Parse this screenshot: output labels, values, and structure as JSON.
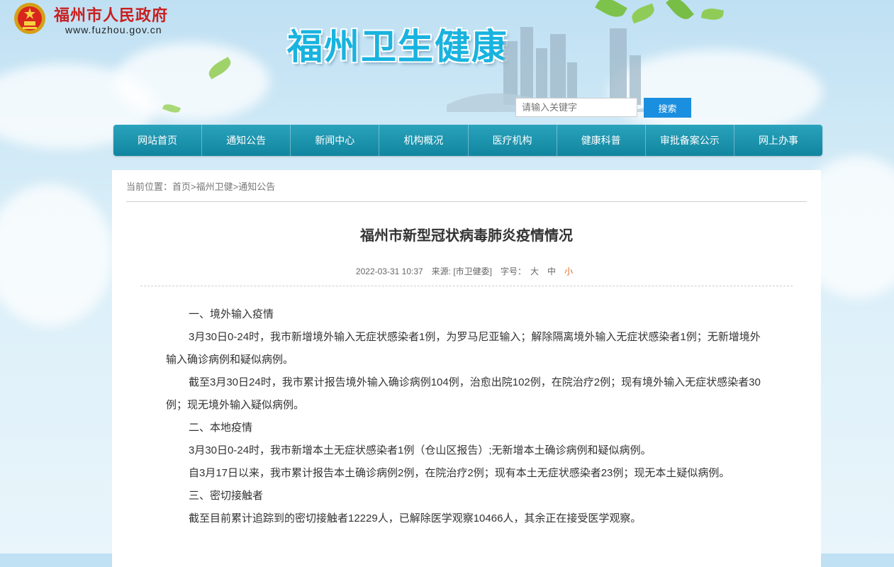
{
  "header": {
    "site_name": "福州市人民政府",
    "site_url": "www.fuzhou.gov.cn",
    "banner_title": "福州卫生健康"
  },
  "search": {
    "placeholder": "请输入关键字",
    "button_label": "搜索"
  },
  "nav": {
    "items": [
      "网站首页",
      "通知公告",
      "新闻中心",
      "机构概况",
      "医疗机构",
      "健康科普",
      "审批备案公示",
      "网上办事"
    ]
  },
  "breadcrumb": {
    "prefix": "当前位置：",
    "home": "首页",
    "level1": "福州卫健",
    "level2": "通知公告",
    "sep": ">"
  },
  "article": {
    "title": "福州市新型冠状病毒肺炎疫情情况",
    "date": "2022-03-31 10:37",
    "source": "来源: [市卫健委]",
    "font_size_label": "字号：",
    "size_large": "大",
    "size_medium": "中",
    "size_small": "小",
    "paragraphs": [
      "一、境外输入疫情",
      "3月30日0-24时，我市新增境外输入无症状感染者1例，为罗马尼亚输入；解除隔离境外输入无症状感染者1例；无新增境外输入确诊病例和疑似病例。",
      "截至3月30日24时，我市累计报告境外输入确诊病例104例，治愈出院102例，在院治疗2例；现有境外输入无症状感染者30例；现无境外输入疑似病例。",
      "二、本地疫情",
      "3月30日0-24时，我市新增本土无症状感染者1例（仓山区报告）;无新增本土确诊病例和疑似病例。",
      "自3月17日以来，我市累计报告本土确诊病例2例，在院治疗2例；现有本土无症状感染者23例；现无本土疑似病例。",
      "三、密切接触者",
      "截至目前累计追踪到的密切接触者12229人，已解除医学观察10466人，其余正在接受医学观察。"
    ]
  },
  "colors": {
    "nav_bg": "#1a93ad",
    "search_button": "#1a8fe0",
    "banner_title": "#19b3df",
    "site_name": "#c91f1f",
    "active_font_size": "#e06a2c"
  }
}
